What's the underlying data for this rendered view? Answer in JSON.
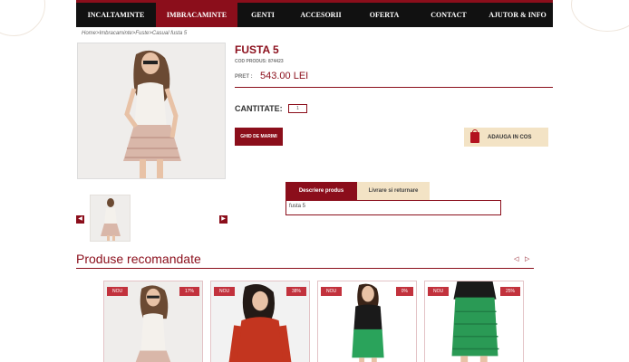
{
  "nav": {
    "items": [
      {
        "label": "INCALTAMINTE",
        "active": false
      },
      {
        "label": "IMBRACAMINTE",
        "active": true
      },
      {
        "label": "GENTI",
        "active": false
      },
      {
        "label": "ACCESORII",
        "active": false
      },
      {
        "label": "OFERTA",
        "active": false
      },
      {
        "label": "CONTACT",
        "active": false
      },
      {
        "label": "AJUTOR & INFO",
        "active": false
      }
    ]
  },
  "breadcrumb": "Home>Imbracaminte>Fuste>Casual fusta 5",
  "product": {
    "title": "FUSTA 5",
    "code": "COD PRODUS: 874423",
    "price_label": "PRET :",
    "price": "543.00 LEI",
    "qty_label": "CANTITATE:",
    "qty_value": "1",
    "size_button": "GHID DE MARIMI",
    "cart_button": "ADAUGA IN COS"
  },
  "tabs": [
    {
      "label": "Descriere produs",
      "active": true
    },
    {
      "label": "Livrare si returnare",
      "active": false
    }
  ],
  "description": "fusta 5",
  "recommended": {
    "title": "Produse recomandate",
    "cards": [
      {
        "badge": "NOU",
        "discount": "17%"
      },
      {
        "badge": "NOU",
        "discount": "38%"
      },
      {
        "badge": "NOU",
        "discount": "0%"
      },
      {
        "badge": "NOU",
        "discount": "25%"
      }
    ]
  },
  "colors": {
    "accent": "#8b0e1b",
    "nav_bg": "#111111",
    "cart_bg": "#f3e3c5"
  }
}
